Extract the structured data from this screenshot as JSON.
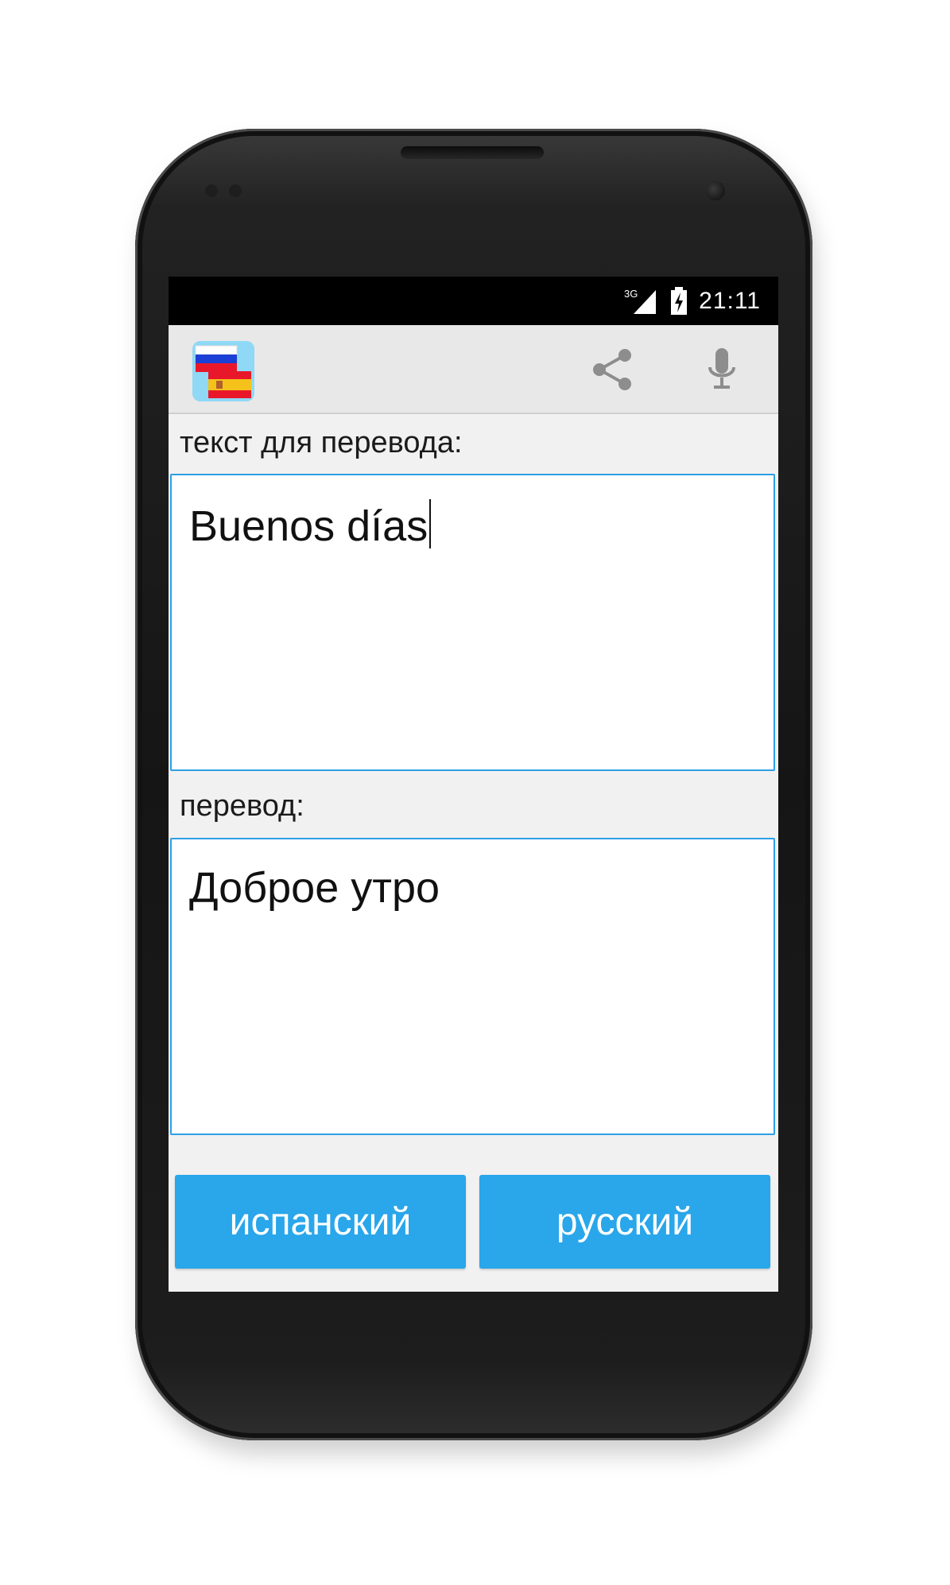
{
  "statusbar": {
    "network": "3G",
    "time": "21:11"
  },
  "actionbar": {
    "app_icon": "ru-es-flags-icon",
    "share_icon": "share-icon",
    "mic_icon": "microphone-icon"
  },
  "input_section": {
    "label": "текст для перевода:",
    "value": "Buenos días"
  },
  "output_section": {
    "label": "перевод:",
    "value": "Доброе утро"
  },
  "buttons": {
    "source_language": "испанский",
    "target_language": "русский"
  },
  "colors": {
    "accent": "#2aa6ea",
    "field_border": "#2d9fe4",
    "background": "#f1f1f1",
    "actionbar": "#e8e8e8"
  }
}
